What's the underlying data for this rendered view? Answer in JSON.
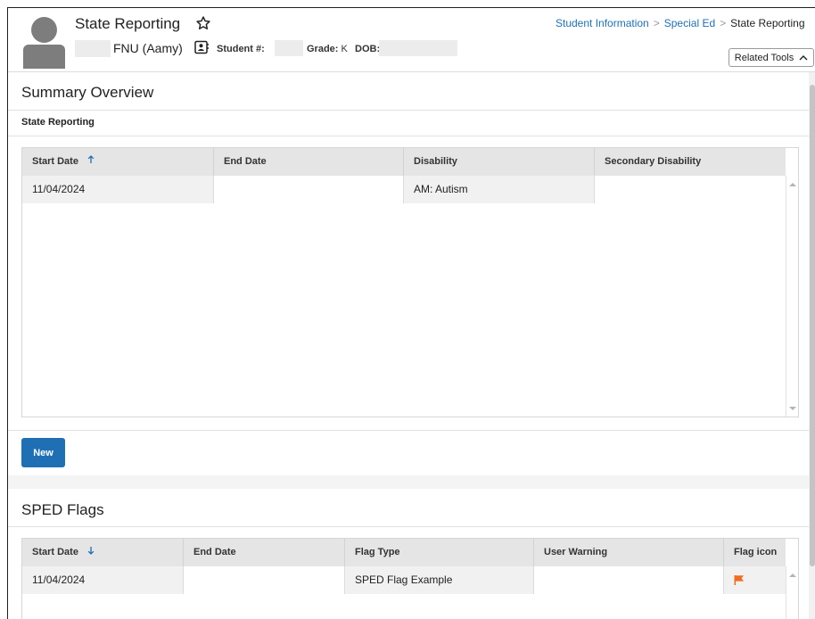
{
  "header": {
    "title": "State Reporting",
    "student_name": "FNU (Aamy)",
    "student_num_label": "Student #:",
    "grade_label": "Grade:",
    "grade_value": "K",
    "dob_label": "DOB:",
    "related_tools": "Related Tools"
  },
  "breadcrumb": {
    "items": [
      "Student Information",
      "Special Ed",
      "State Reporting"
    ]
  },
  "summary": {
    "title": "Summary Overview",
    "subtitle": "State Reporting",
    "columns": [
      "Start Date",
      "End Date",
      "Disability",
      "Secondary Disability"
    ],
    "rows": [
      {
        "start": "11/04/2024",
        "end": "",
        "disability": "AM: Autism",
        "secondary": ""
      }
    ],
    "new_button": "New"
  },
  "flags": {
    "title": "SPED Flags",
    "columns": [
      "Start Date",
      "End Date",
      "Flag Type",
      "User Warning",
      "Flag icon"
    ],
    "rows": [
      {
        "start": "11/04/2024",
        "end": "",
        "flag_type": "SPED Flag Example",
        "warning": ""
      }
    ]
  },
  "colors": {
    "accent": "#1f6fb5",
    "flag": "#f26b21",
    "avatar": "#7d7d7d"
  },
  "icons": {
    "favorite": "star-outline-icon",
    "contact_card": "contact-card-icon",
    "sort_asc": "arrow-up-icon",
    "sort_desc": "arrow-down-icon",
    "flag": "flag-icon",
    "chevron": "chevron-up-icon"
  }
}
